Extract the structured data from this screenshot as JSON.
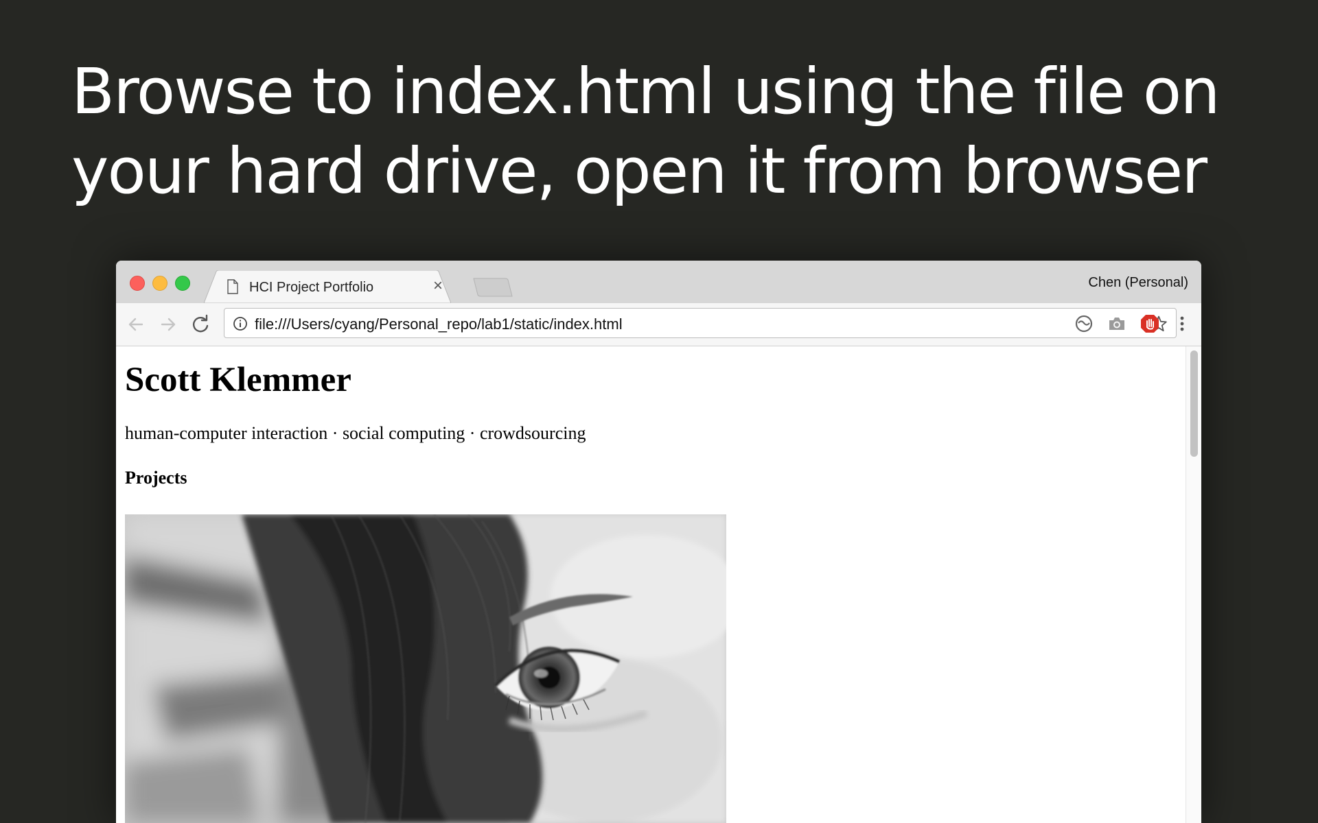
{
  "slide": {
    "title_line1": "Browse to index.html using the file on",
    "title_line2": "your hard drive, open it from browser"
  },
  "browser": {
    "tab": {
      "title": "HCI Project Portfolio",
      "close_glyph": "×",
      "icon": "document-icon"
    },
    "profile": "Chen (Personal)",
    "address_bar": {
      "url": "file:///Users/cyang/Personal_repo/lab1/static/index.html"
    },
    "toolbar_icons": [
      "back-icon",
      "forward-icon",
      "reload-icon",
      "info-icon",
      "star-icon",
      "sync-icon",
      "camera-icon",
      "adblock-icon",
      "menu-icon"
    ]
  },
  "page": {
    "heading": "Scott Klemmer",
    "tagline": "human-computer interaction · social computing · crowdsourcing",
    "section_title": "Projects",
    "image": "grayscale close-up photo"
  },
  "colors": {
    "slide_background": "#262723",
    "traffic_red": "#fc605c",
    "traffic_yellow": "#fdbc40",
    "traffic_green": "#34c84a",
    "adblock_red": "#d93025"
  }
}
